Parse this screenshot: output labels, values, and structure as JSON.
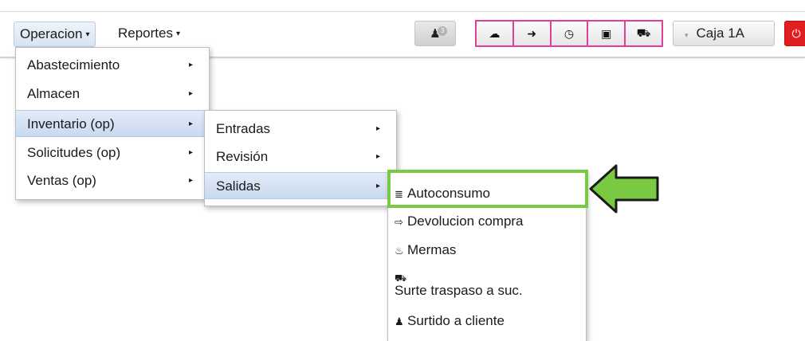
{
  "navbar": {
    "menus": [
      {
        "label": "Operacion"
      },
      {
        "label": "Reportes"
      }
    ],
    "badge_count": "3",
    "cash_register_label": "Caja 1A"
  },
  "menu_level1": {
    "items": [
      {
        "label": "Abastecimiento"
      },
      {
        "label": "Almacen"
      },
      {
        "label": "Inventario (op)"
      },
      {
        "label": "Solicitudes (op)"
      },
      {
        "label": "Ventas (op)"
      }
    ]
  },
  "menu_level2": {
    "items": [
      {
        "label": "Entradas"
      },
      {
        "label": "Revisión"
      },
      {
        "label": "Salidas"
      }
    ]
  },
  "menu_level3": {
    "items": [
      {
        "label": "Autoconsumo",
        "icon": "list-icon"
      },
      {
        "label": "Devolucion compra",
        "icon": "return-icon"
      },
      {
        "label": "Mermas",
        "icon": "waste-icon"
      },
      {
        "label": "Surte traspaso a suc.",
        "icon": "truck-icon"
      },
      {
        "label": "Surtido a cliente",
        "icon": "user-icon"
      }
    ]
  },
  "colors": {
    "highlight_pink": "#e0409a",
    "highlight_green": "#7ac943",
    "power_red": "#e02020"
  }
}
